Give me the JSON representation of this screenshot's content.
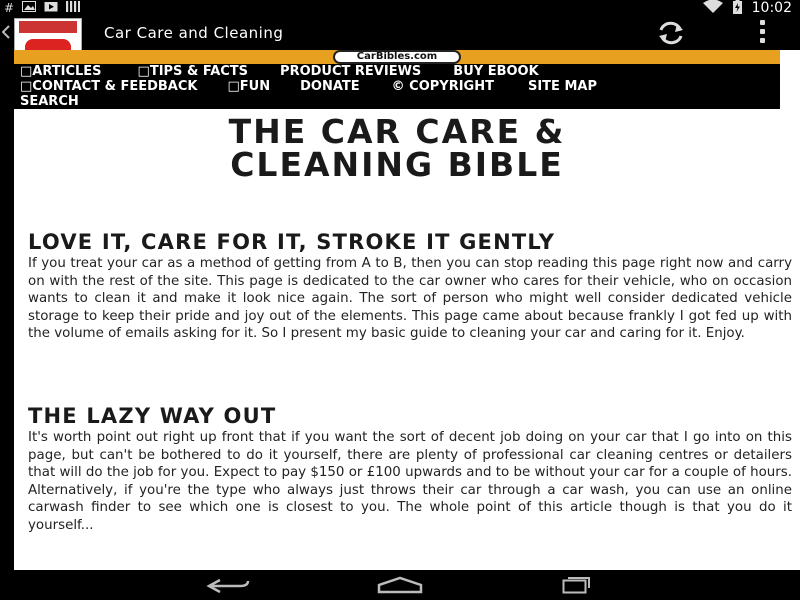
{
  "status_bar": {
    "left_icons": [
      "hash-icon",
      "image-icon",
      "play-store-icon",
      "signal-bars-icon"
    ],
    "right_icons": [
      "wifi-icon",
      "battery-charging-icon"
    ],
    "time": "10:02"
  },
  "action_bar": {
    "title": "Car Care and Cleaning",
    "icons": [
      "back-arrow-icon",
      "app-icon",
      "refresh-icon",
      "overflow-menu-icon"
    ]
  },
  "site": {
    "banner_logo": "CarBibles.com",
    "nav": {
      "row1": [
        "□ARTICLES",
        "□TIPS & FACTS",
        "PRODUCT REVIEWS",
        "BUY EBOOK"
      ],
      "row2": [
        "□CONTACT & FEEDBACK",
        "□FUN",
        "DONATE",
        "© COPYRIGHT",
        "SITE MAP"
      ],
      "row3": [
        "SEARCH"
      ]
    },
    "page_title_line1": "THE CAR CARE &",
    "page_title_line2": "CLEANING BIBLE",
    "sections": [
      {
        "heading": "LOVE IT, CARE FOR IT, STROKE IT GENTLY",
        "body": "If you treat your car as a method of getting from A to B, then you can stop reading this page right now and carry on with the rest of the site. This page is dedicated to the car owner who cares for their vehicle, who on occasion wants to clean it and make it look nice again. The sort of person who might well consider dedicated vehicle storage to keep their pride and joy out of the elements. This page came about because frankly I got fed up with the volume of emails asking for it. So I present my basic guide to cleaning your car and caring for it. Enjoy."
      },
      {
        "heading": "THE LAZY WAY OUT",
        "body": "It's worth point out right up front that if you want the sort of decent job doing on your car that I go into on this page, but can't be bothered to do it yourself, there are plenty of professional car cleaning centres or detailers that will do the job for you. Expect to pay $150 or £100 upwards and to be without your car for a couple of hours. Alternatively, if you're the type who always just throws their car through a car wash, you can use an online carwash finder to see which one is closest to you. The whole point of this article though is that you do it yourself..."
      }
    ]
  },
  "nav_bar": {
    "icons": [
      "back-icon",
      "home-icon",
      "recent-apps-icon"
    ]
  },
  "colors": {
    "banner": "#e8a020",
    "nav_bg": "#000000",
    "nav_text": "#ffffff",
    "text": "#1a1a1a"
  }
}
